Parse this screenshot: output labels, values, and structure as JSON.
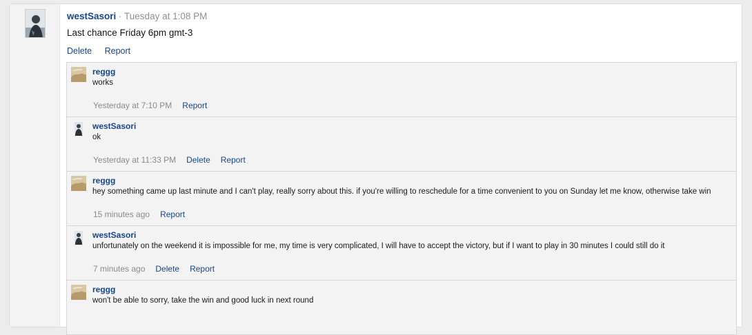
{
  "post": {
    "author": "westSasori",
    "separator": "·",
    "time": "Tuesday at 1:08 PM",
    "message": "Last chance Friday 6pm gmt-3",
    "actions": {
      "delete": "Delete",
      "report": "Report"
    },
    "avatar_icon": "user-avatar-icon"
  },
  "comments": [
    {
      "author": "reggg",
      "avatar_icon": "user-avatar-icon",
      "text": "works",
      "time": "Yesterday at 7:10 PM",
      "delete": "",
      "report": "Report"
    },
    {
      "author": "westSasori",
      "avatar_icon": "user-avatar-icon",
      "text": "ok",
      "time": "Yesterday at 11:33 PM",
      "delete": "Delete",
      "report": "Report"
    },
    {
      "author": "reggg",
      "avatar_icon": "user-avatar-icon",
      "text": "hey something came up last minute and I can't play, really sorry about this. if you're willing to reschedule for a time convenient to you on Sunday let me know, otherwise take win",
      "time": "15 minutes ago",
      "delete": "",
      "report": "Report"
    },
    {
      "author": "westSasori",
      "avatar_icon": "user-avatar-icon",
      "text": "unfortunately on the weekend it is impossible for me, my time is very complicated, I will have to accept the victory, but if I want to play in 30 minutes I could still do it",
      "time": "7 minutes ago",
      "delete": "Delete",
      "report": "Report"
    },
    {
      "author": "reggg",
      "avatar_icon": "user-avatar-icon",
      "text": "won't be able to sorry, take the win and good luck in next round",
      "time": "",
      "delete": "",
      "report": ""
    }
  ],
  "colors": {
    "link": "#15468a",
    "muted": "#8a8a8a",
    "comment_bg": "#f3f3f3",
    "border": "#d6d6d6",
    "page_bg": "#ececec"
  }
}
